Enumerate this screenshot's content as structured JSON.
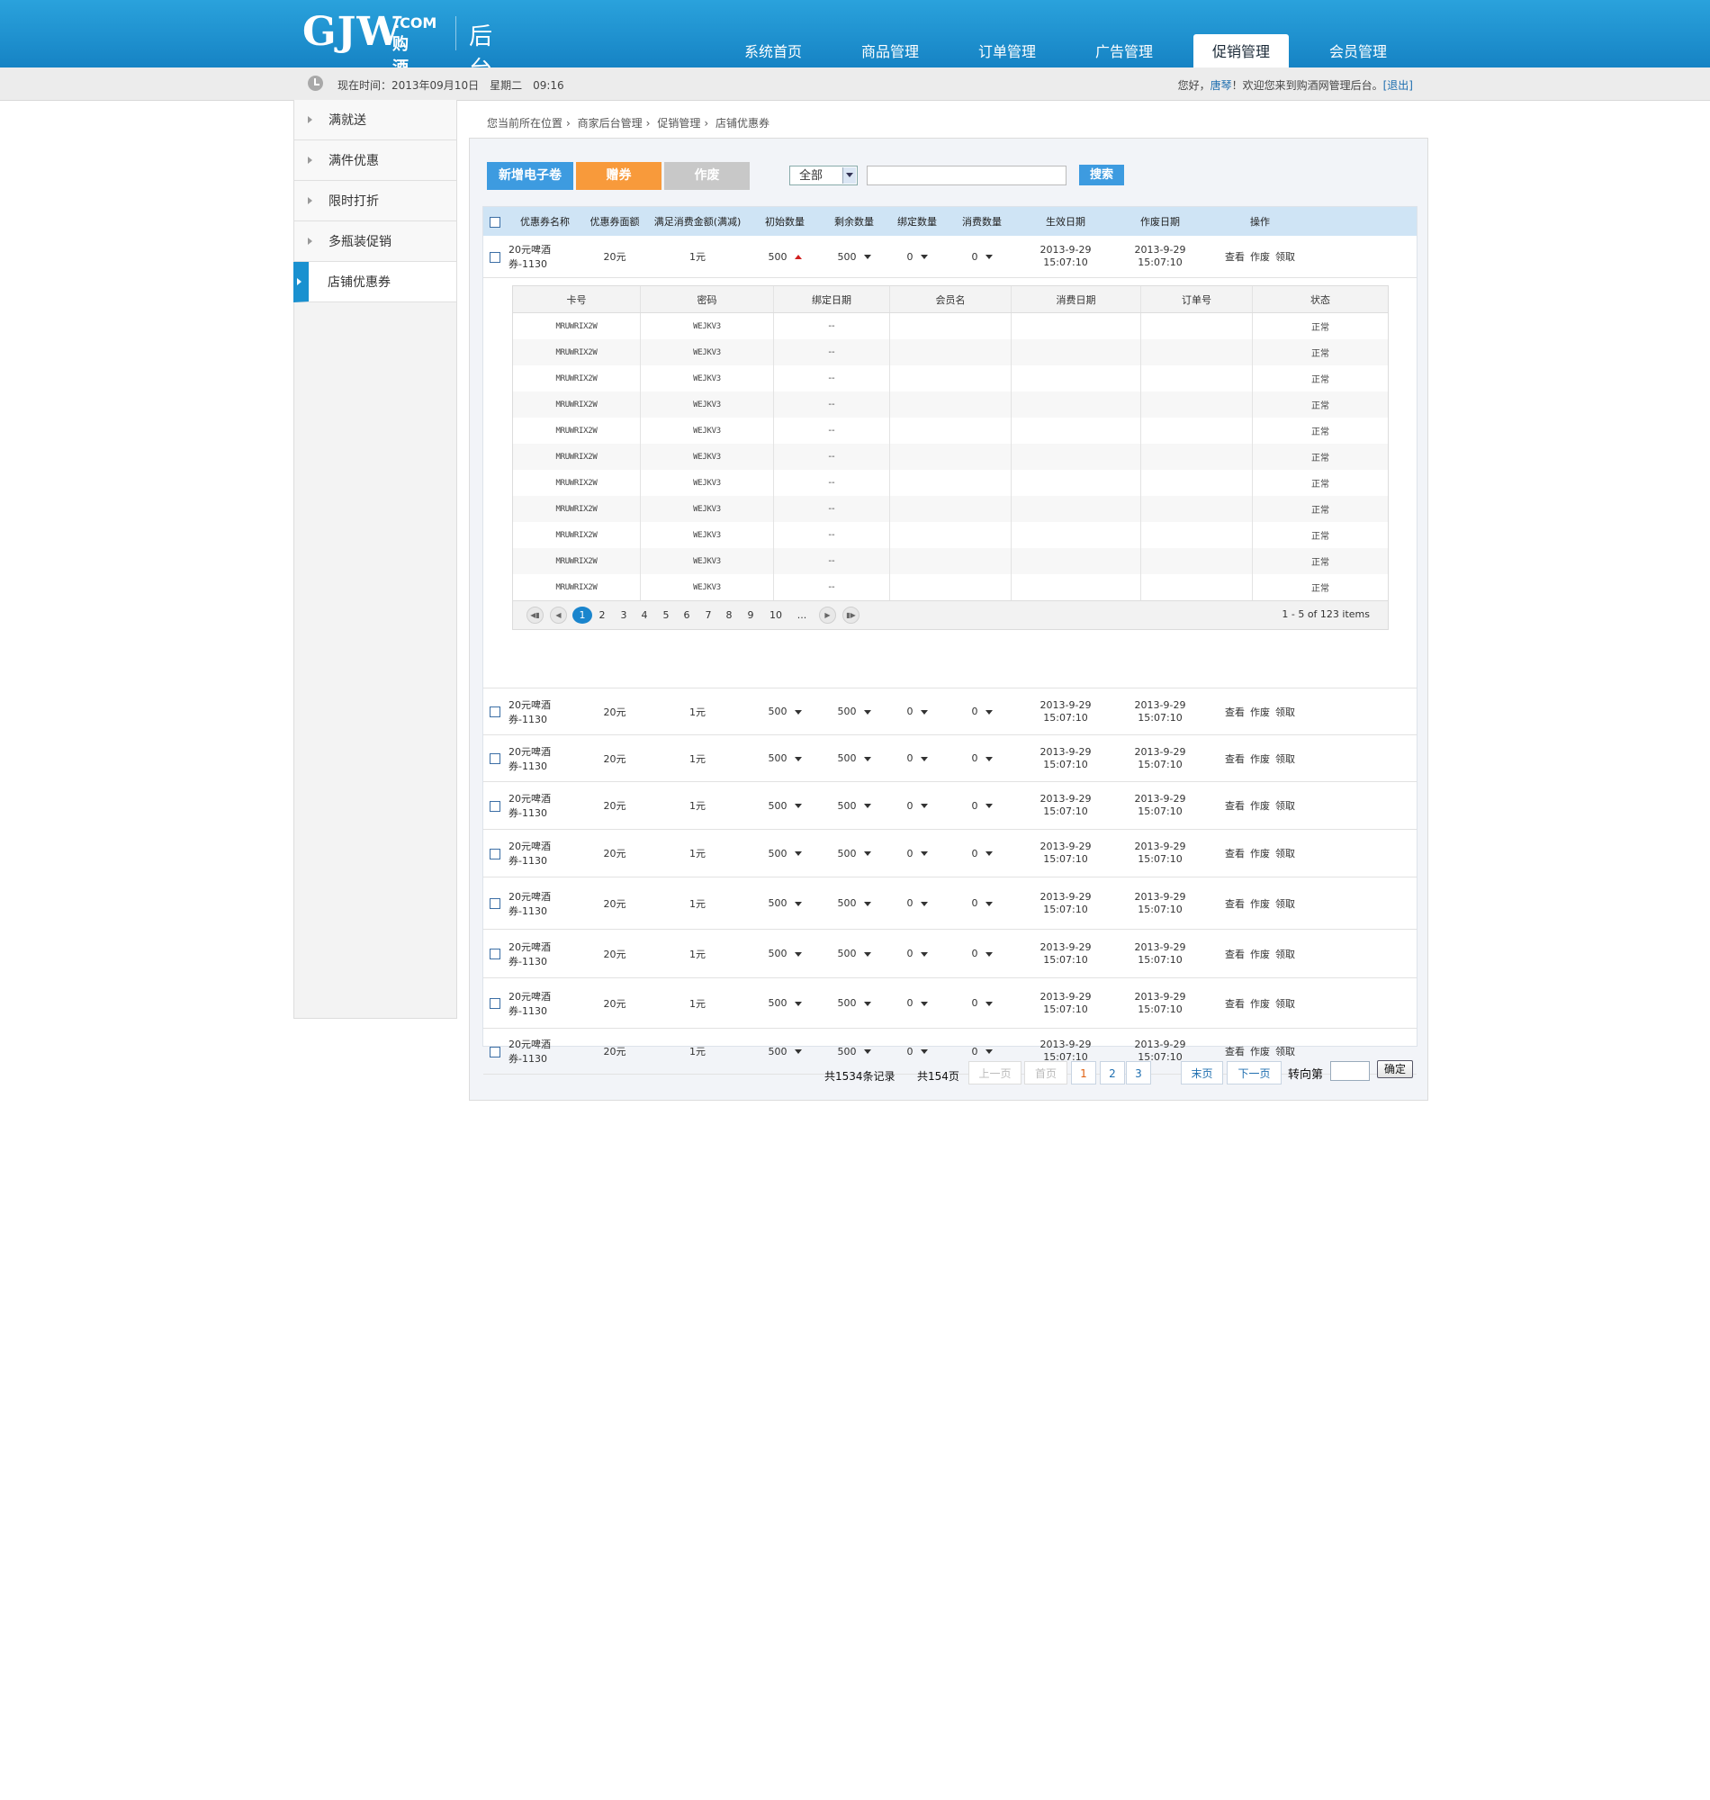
{
  "header": {
    "logo_main": "GJW",
    "logo_com": ".COM",
    "logo_cn": "购酒网",
    "admin_title": "后台管理",
    "nav": [
      "系统首页",
      "商品管理",
      "订单管理",
      "广告管理",
      "促销管理",
      "会员管理"
    ],
    "nav_active": "促销管理"
  },
  "subbar": {
    "time_label": "现在时间：2013年09月10日　星期二　09:16",
    "greeting": "您好，",
    "user": "唐琴",
    "welcome": "！欢迎您来到购酒网管理后台。",
    "logout": "[退出]"
  },
  "sidebar": {
    "items": [
      "满就送",
      "满件优惠",
      "限时打折",
      "多瓶装促销",
      "店铺优惠券"
    ],
    "active": "店铺优惠券"
  },
  "breadcrumb": [
    "您当前所在位置",
    "商家后台管理",
    "促销管理",
    "店铺优惠券"
  ],
  "toolbar": {
    "new_label": "新增电子卷",
    "gift_label": "赠券",
    "void_label": "作废",
    "filter_value": "全部",
    "search_label": "搜索"
  },
  "table": {
    "headers": [
      "优惠券名称",
      "优惠券面额",
      "满足消费金额(满减)",
      "初始数量",
      "剩余数量",
      "绑定数量",
      "消费数量",
      "生效日期",
      "作废日期",
      "操作"
    ],
    "rows": [
      {
        "name": "20元啤酒券-1130",
        "value": "20元",
        "min": "1元",
        "init": "500",
        "left": "500",
        "bound": "0",
        "used": "0",
        "start_date": "2013-9-29",
        "start_time": "15:07:10",
        "end_date": "2013-9-29",
        "end_time": "15:07:10"
      },
      {
        "name": "20元啤酒券-1130",
        "value": "20元",
        "min": "1元",
        "init": "500",
        "left": "500",
        "bound": "0",
        "used": "0",
        "start_date": "2013-9-29",
        "start_time": "15:07:10",
        "end_date": "2013-9-29",
        "end_time": "15:07:10"
      },
      {
        "name": "20元啤酒券-1130",
        "value": "20元",
        "min": "1元",
        "init": "500",
        "left": "500",
        "bound": "0",
        "used": "0",
        "start_date": "2013-9-29",
        "start_time": "15:07:10",
        "end_date": "2013-9-29",
        "end_time": "15:07:10"
      },
      {
        "name": "20元啤酒券-1130",
        "value": "20元",
        "min": "1元",
        "init": "500",
        "left": "500",
        "bound": "0",
        "used": "0",
        "start_date": "2013-9-29",
        "start_time": "15:07:10",
        "end_date": "2013-9-29",
        "end_time": "15:07:10"
      },
      {
        "name": "20元啤酒券-1130",
        "value": "20元",
        "min": "1元",
        "init": "500",
        "left": "500",
        "bound": "0",
        "used": "0",
        "start_date": "2013-9-29",
        "start_time": "15:07:10",
        "end_date": "2013-9-29",
        "end_time": "15:07:10"
      },
      {
        "name": "20元啤酒券-1130",
        "value": "20元",
        "min": "1元",
        "init": "500",
        "left": "500",
        "bound": "0",
        "used": "0",
        "start_date": "2013-9-29",
        "start_time": "15:07:10",
        "end_date": "2013-9-29",
        "end_time": "15:07:10"
      },
      {
        "name": "20元啤酒券-1130",
        "value": "20元",
        "min": "1元",
        "init": "500",
        "left": "500",
        "bound": "0",
        "used": "0",
        "start_date": "2013-9-29",
        "start_time": "15:07:10",
        "end_date": "2013-9-29",
        "end_time": "15:07:10"
      },
      {
        "name": "20元啤酒券-1130",
        "value": "20元",
        "min": "1元",
        "init": "500",
        "left": "500",
        "bound": "0",
        "used": "0",
        "start_date": "2013-9-29",
        "start_time": "15:07:10",
        "end_date": "2013-9-29",
        "end_time": "15:07:10"
      },
      {
        "name": "20元啤酒券-1130",
        "value": "20元",
        "min": "1元",
        "init": "500",
        "left": "500",
        "bound": "0",
        "used": "0",
        "start_date": "2013-9-29",
        "start_time": "15:07:10",
        "end_date": "2013-9-29",
        "end_time": "15:07:10"
      }
    ],
    "ops": [
      "查看",
      "作废",
      "领取"
    ],
    "expanded_row": 0
  },
  "subtable": {
    "headers": [
      "卡号",
      "密码",
      "绑定日期",
      "会员名",
      "消费日期",
      "订单号",
      "状态"
    ],
    "rows": [
      {
        "card": "MRUWRIX2W",
        "pwd": "WEJKV3",
        "bind": "--",
        "status": "正常"
      },
      {
        "card": "MRUWRIX2W",
        "pwd": "WEJKV3",
        "bind": "--",
        "status": "正常"
      },
      {
        "card": "MRUWRIX2W",
        "pwd": "WEJKV3",
        "bind": "--",
        "status": "正常"
      },
      {
        "card": "MRUWRIX2W",
        "pwd": "WEJKV3",
        "bind": "--",
        "status": "正常"
      },
      {
        "card": "MRUWRIX2W",
        "pwd": "WEJKV3",
        "bind": "--",
        "status": "正常"
      },
      {
        "card": "MRUWRIX2W",
        "pwd": "WEJKV3",
        "bind": "--",
        "status": "正常"
      },
      {
        "card": "MRUWRIX2W",
        "pwd": "WEJKV3",
        "bind": "--",
        "status": "正常"
      },
      {
        "card": "MRUWRIX2W",
        "pwd": "WEJKV3",
        "bind": "--",
        "status": "正常"
      },
      {
        "card": "MRUWRIX2W",
        "pwd": "WEJKV3",
        "bind": "--",
        "status": "正常"
      },
      {
        "card": "MRUWRIX2W",
        "pwd": "WEJKV3",
        "bind": "--",
        "status": "正常"
      },
      {
        "card": "MRUWRIX2W",
        "pwd": "WEJKV3",
        "bind": "--",
        "status": "正常"
      }
    ],
    "pager": {
      "first_icon": "first-page-icon",
      "prev_icon": "prev-page-icon",
      "pages": [
        "1",
        "2",
        "3",
        "4",
        "5",
        "6",
        "7",
        "8",
        "9",
        "10",
        "..."
      ],
      "current": "1",
      "next_icon": "next-page-icon",
      "last_icon": "last-page-icon",
      "info": "1 - 5 of 123 items"
    }
  },
  "footer_pager": {
    "total_records": "共1534条记录",
    "total_pages": "共154页",
    "prev": "上一页",
    "first": "首页",
    "pages": [
      "1",
      "2",
      "3"
    ],
    "current": "1",
    "last": "末页",
    "next": "下一页",
    "goto_label": "转向第",
    "ok": "确定"
  }
}
